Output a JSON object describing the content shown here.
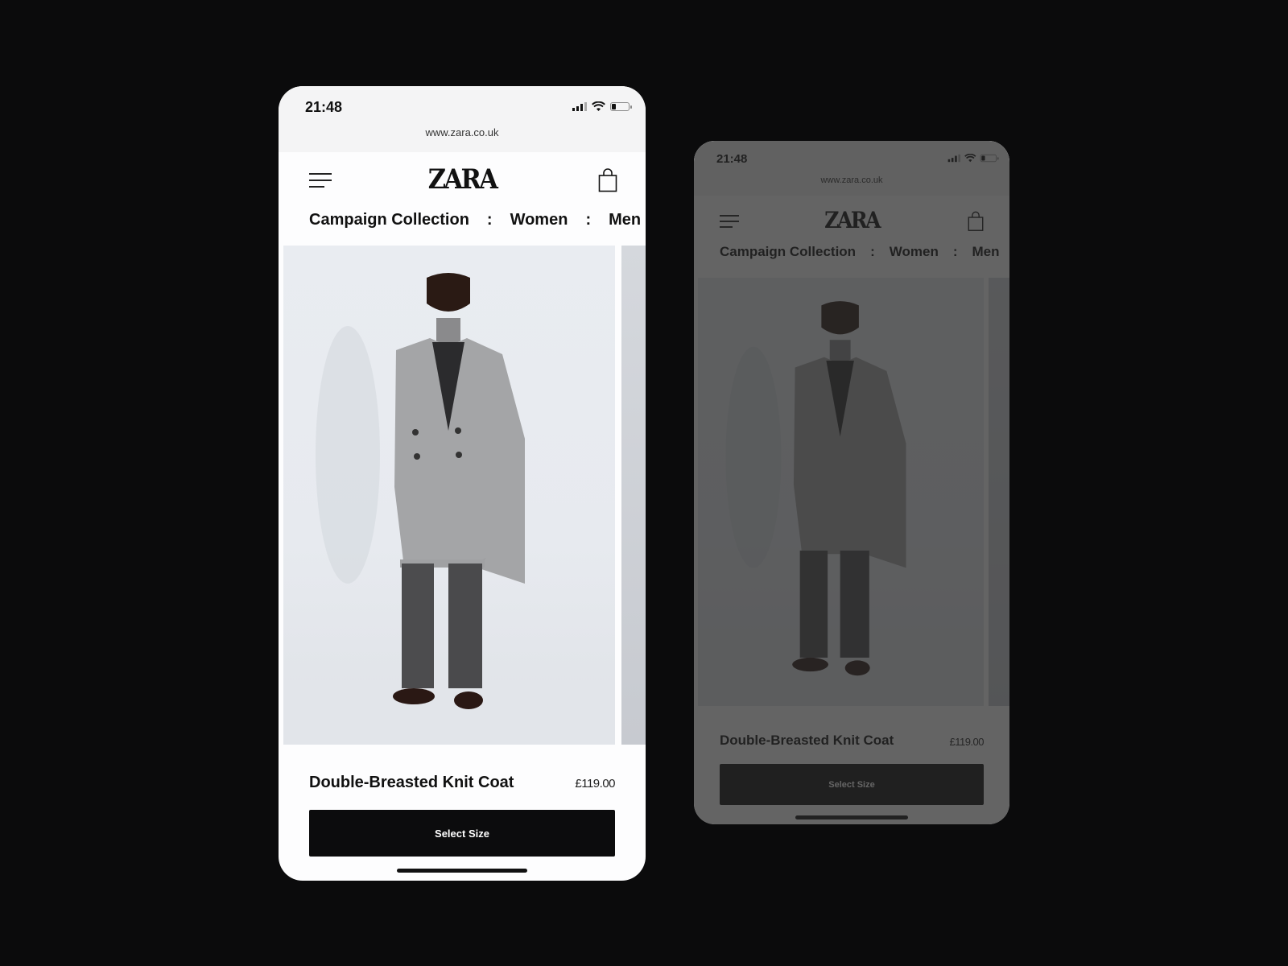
{
  "status_bar": {
    "time": "21:48",
    "url": "www.zara.co.uk"
  },
  "header": {
    "logo": "ZARA",
    "menu_icon": "hamburger-menu-icon",
    "bag_icon": "shopping-bag-icon"
  },
  "nav": {
    "items": [
      "Campaign Collection",
      "Women",
      "Men"
    ],
    "separator": ":"
  },
  "product": {
    "title": "Double-Breasted Knit Coat",
    "price": "£119.00",
    "image": "model-in-grey-double-breasted-coat"
  },
  "cta": {
    "label": "Select Size"
  },
  "colors": {
    "background": "#0b0b0c",
    "button": "#0c0c0d",
    "page": "#fdfdfe",
    "image_bg": "#e8ebf0"
  }
}
